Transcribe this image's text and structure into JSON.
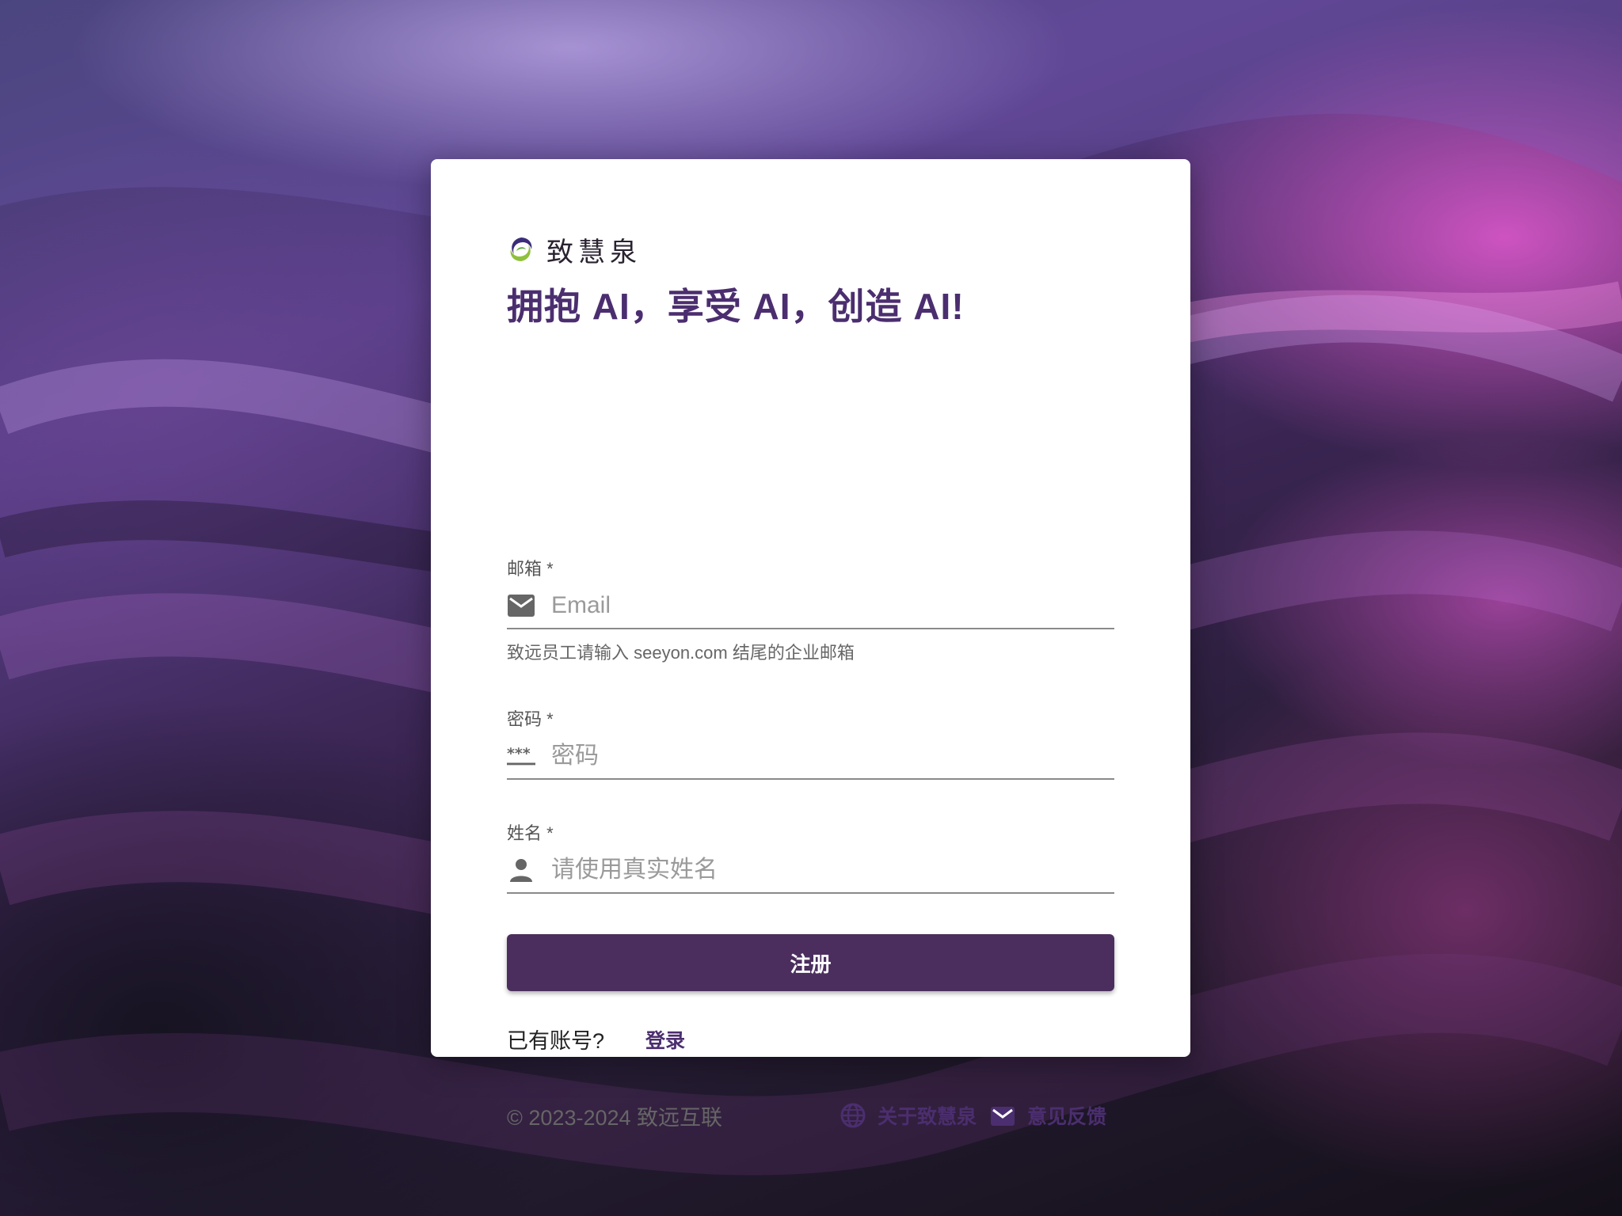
{
  "brand": {
    "name": "致慧泉"
  },
  "headline": "拥抱 AI，享受 AI，创造 AI!",
  "form": {
    "email": {
      "label": "邮箱 *",
      "placeholder": "Email",
      "value": "",
      "icon": "mail-icon",
      "hint": "致远员工请输入 seeyon.com 结尾的企业邮箱"
    },
    "password": {
      "label": "密码 *",
      "placeholder": "密码",
      "value": "",
      "icon": "password-icon"
    },
    "name": {
      "label": "姓名 *",
      "placeholder": "请使用真实姓名",
      "value": "",
      "icon": "person-icon"
    },
    "submit_label": "注册"
  },
  "account": {
    "question": "已有账号?",
    "login_label": "登录"
  },
  "footer": {
    "copyright": "© 2023-2024 致远互联",
    "about_label": "关于致慧泉",
    "about_icon": "globe-icon",
    "feedback_label": "意见反馈",
    "feedback_icon": "mail-icon"
  },
  "colors": {
    "primary": "#4b2e5e",
    "heading": "#4b2e6f",
    "card": "#ffffff"
  }
}
